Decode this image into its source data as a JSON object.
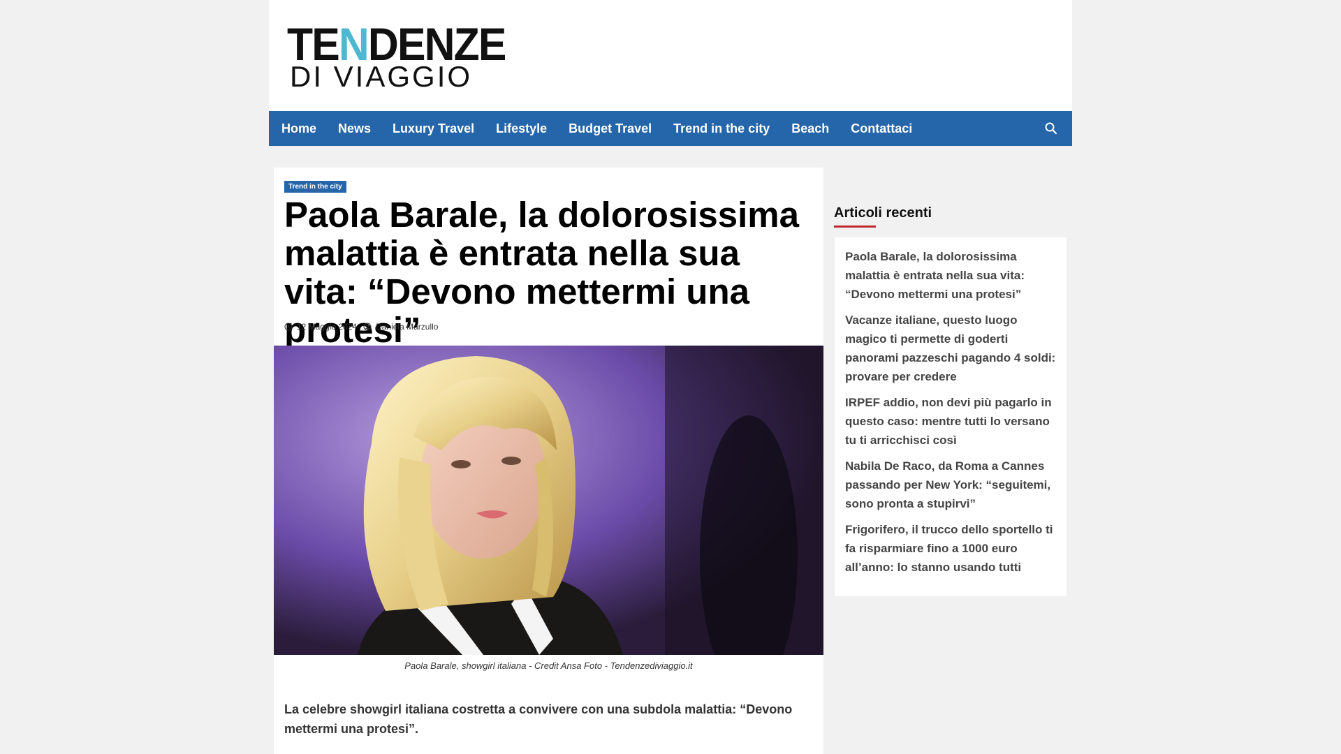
{
  "header": {
    "logo": {
      "line1_part1": "TE",
      "line1_accent": "N",
      "line1_part2": "DENZE",
      "line2": "DI VIAGGIO"
    }
  },
  "nav": {
    "items": [
      {
        "label": "Home"
      },
      {
        "label": "News"
      },
      {
        "label": "Luxury Travel"
      },
      {
        "label": "Lifestyle"
      },
      {
        "label": "Budget Travel"
      },
      {
        "label": "Trend in the city"
      },
      {
        "label": "Beach"
      },
      {
        "label": "Contattaci"
      }
    ],
    "search_icon": "search-icon"
  },
  "article": {
    "category": "Trend in the city",
    "title": "Paola Barale, la dolorosissima malattia è entrata nella sua vita: “Devono mettermi una protesi”",
    "date": "12 Maggio 2024",
    "author": "Daniela Marzullo",
    "image_caption": "Paola Barale, showgirl italiana - Credit Ansa Foto - Tendenzediviaggio.it",
    "lead": "La celebre showgirl italiana costretta a convivere con una subdola malattia: “Devono mettermi una protesi”."
  },
  "sidebar": {
    "heading": "Articoli recenti",
    "items": [
      {
        "title": "Paola Barale, la dolorosissima malattia è entrata nella sua vita: “Devono mettermi una protesi”"
      },
      {
        "title": "Vacanze italiane, questo luogo magico ti permette di goderti panorami pazzeschi pagando 4 soldi: provare per credere"
      },
      {
        "title": "IRPEF addio, non devi più pagarlo in questo caso: mentre tutti lo versano tu ti arricchisci così"
      },
      {
        "title": "Nabila De Raco, da Roma a Cannes passando per New York: “seguitemi, sono pronta a stupirvi”"
      },
      {
        "title": "Frigorifero, il trucco dello sportello ti fa risparmiare fino a 1000 euro all’anno: lo stanno usando tutti"
      }
    ]
  },
  "colors": {
    "nav_bg": "#2565a9",
    "logo_accent": "#4fb8d1",
    "sidebar_underline": "#c0282d",
    "page_bg": "#f1f1f1"
  }
}
